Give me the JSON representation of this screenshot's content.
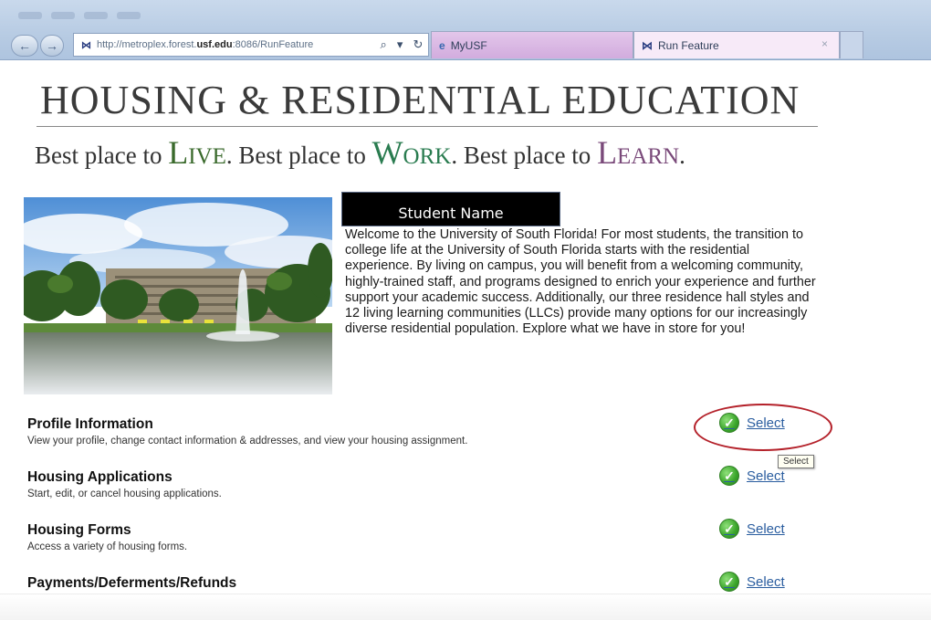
{
  "browser": {
    "address_url": "http://metroplex.forest.",
    "address_url_bold": "usf.edu",
    "address_url_rest": ":8086/RunFeature",
    "address_favicon": "⋈",
    "search_glyph": "⌕",
    "dropdown_glyph": "▾",
    "refresh_glyph": "↻",
    "back_glyph": "←",
    "forward_glyph": "→",
    "tabs": [
      {
        "label": "MyUSF",
        "icon": "ie-icon",
        "glyph": "e"
      },
      {
        "label": "Run Feature",
        "icon": "usf-icon",
        "glyph": "⋈",
        "close": "×"
      }
    ]
  },
  "header": {
    "title": "HOUSING & RESIDENTIAL EDUCATION",
    "tagline": {
      "part1": "Best place to ",
      "live": "Live",
      "part2": ". Best place to ",
      "work": "Work",
      "part3": ". Best place to ",
      "learn": "Learn",
      "part4": "."
    }
  },
  "student_name": "Student Name",
  "welcome_text": "Welcome to the University of South Florida!  For most students, the transition to college life at the University of South Florida starts with the residential experience.  By living on campus, you will benefit from a welcoming community, highly-trained staff, and programs designed to enrich your experience and further support your academic success.  Additionally, our three residence hall styles and 12 living learning communities (LLCs) provide many options for our increasingly diverse residential population.  Explore what we have in store for you!",
  "features": [
    {
      "title": "Profile Information",
      "description": "View your profile, change contact information & addresses, and view your housing assignment.",
      "action": "Select"
    },
    {
      "title": "Housing Applications",
      "description": "Start, edit, or cancel housing applications.",
      "action": "Select"
    },
    {
      "title": "Housing Forms",
      "description": "Access a variety of housing forms.",
      "action": "Select"
    },
    {
      "title": "Payments/Deferments/Refunds",
      "description": "",
      "action": "Select"
    }
  ],
  "check_glyph": "✓",
  "tooltip": "Select",
  "colors": {
    "link": "#2a5d9f",
    "check_green": "#3aa52a",
    "highlight_oval": "#b4212a",
    "live_green": "#3a6a2c",
    "work_green": "#2a7c50",
    "learn_purple": "#7a4a7a"
  }
}
